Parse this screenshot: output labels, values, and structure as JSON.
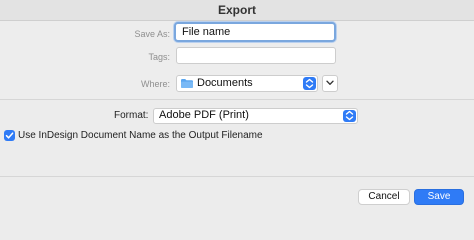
{
  "window": {
    "title": "Export"
  },
  "form": {
    "save_as_label": "Save As:",
    "save_as_value": "File name",
    "tags_label": "Tags:",
    "tags_value": "",
    "where_label": "Where:",
    "where_value": "Documents",
    "format_label": "Format:",
    "format_value": "Adobe PDF (Print)",
    "use_doc_name_label": "Use InDesign Document Name as the Output Filename",
    "use_doc_name_checked": true
  },
  "buttons": {
    "cancel": "Cancel",
    "save": "Save"
  },
  "colors": {
    "accent": "#2f7bf6",
    "background": "#ececec"
  },
  "icons": {
    "folder": "folder-icon",
    "stepper": "up-down-chevron-icon",
    "expand": "chevron-down-icon",
    "checkmark": "checkmark-icon"
  }
}
